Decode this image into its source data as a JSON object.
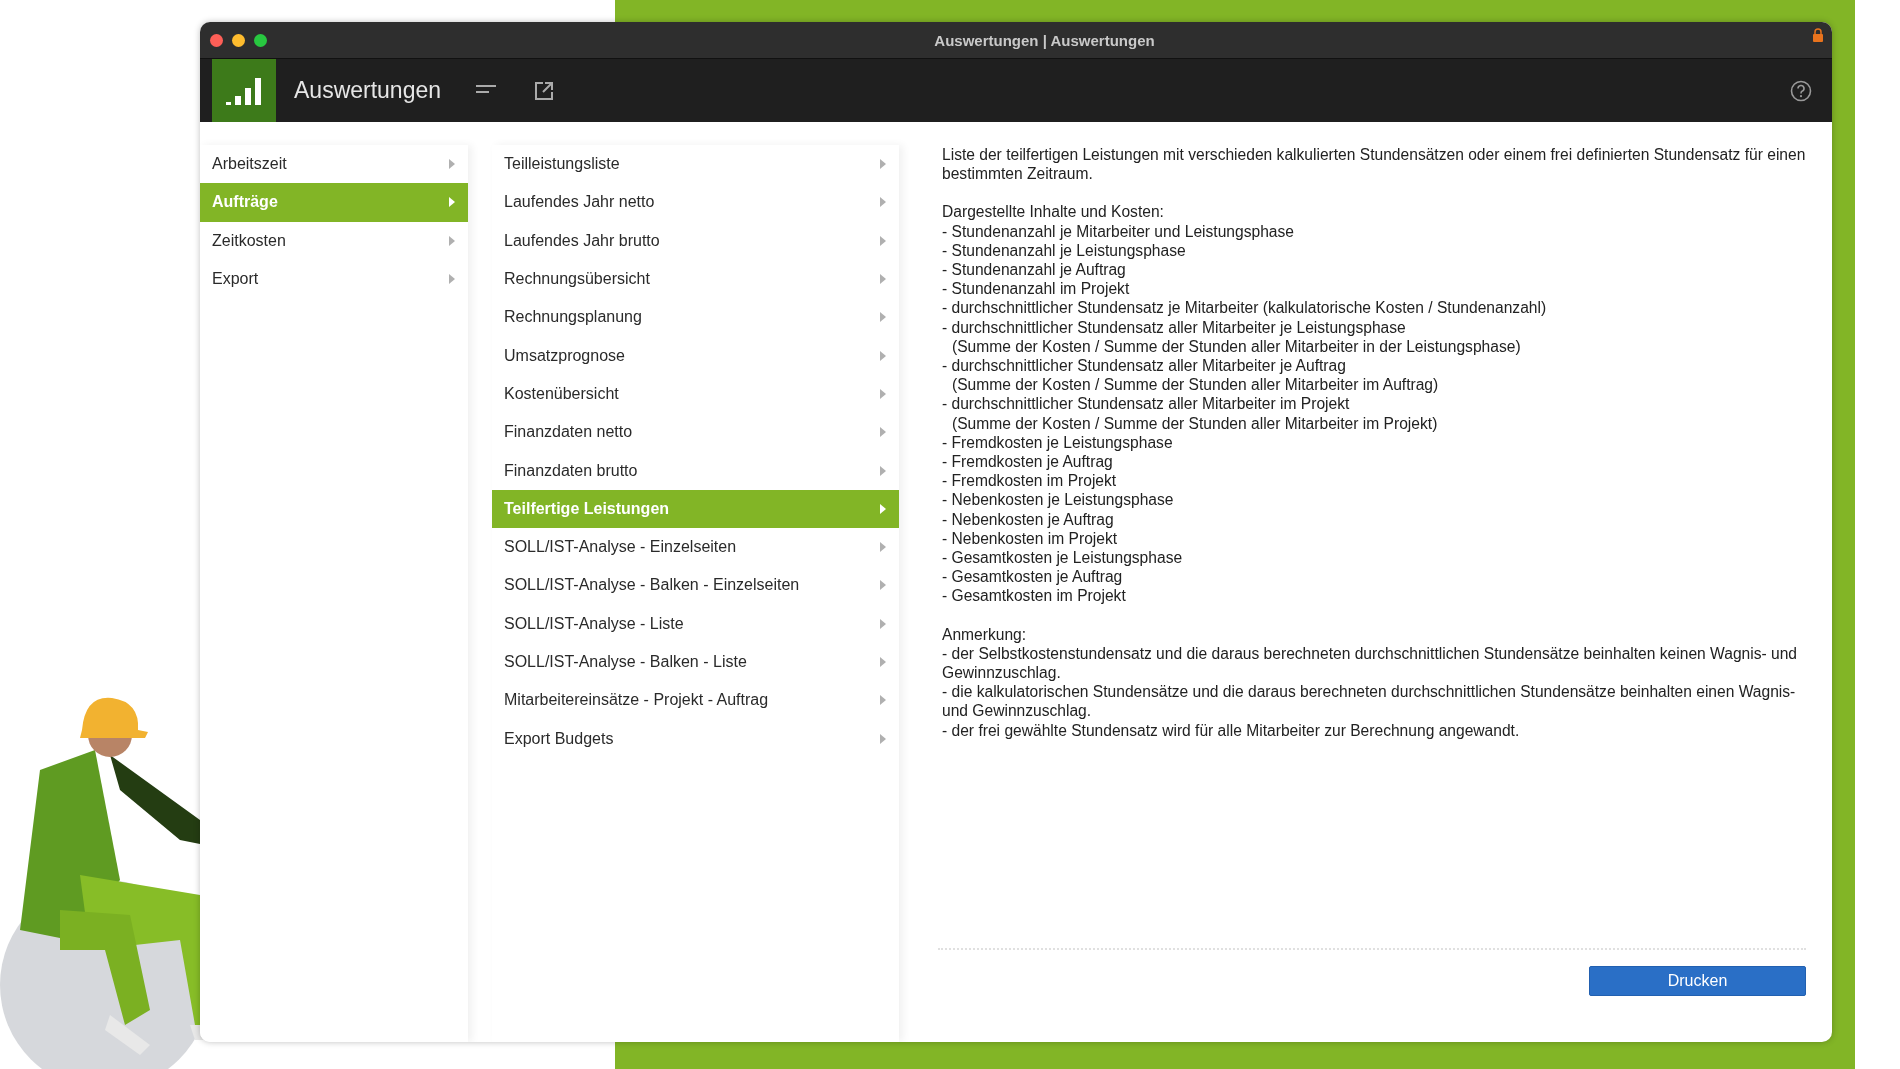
{
  "window": {
    "title": "Auswertungen | Auswertungen"
  },
  "toolbar": {
    "title": "Auswertungen"
  },
  "sidebar": {
    "items": [
      {
        "label": "Arbeitszeit",
        "selected": false
      },
      {
        "label": "Aufträge",
        "selected": true
      },
      {
        "label": "Zeitkosten",
        "selected": false
      },
      {
        "label": "Export",
        "selected": false
      }
    ]
  },
  "submenu": {
    "items": [
      {
        "label": "Teilleistungsliste",
        "selected": false
      },
      {
        "label": "Laufendes Jahr netto",
        "selected": false
      },
      {
        "label": "Laufendes Jahr brutto",
        "selected": false
      },
      {
        "label": "Rechnungsübersicht",
        "selected": false
      },
      {
        "label": "Rechnungsplanung",
        "selected": false
      },
      {
        "label": "Umsatzprognose",
        "selected": false
      },
      {
        "label": "Kostenübersicht",
        "selected": false
      },
      {
        "label": "Finanzdaten netto",
        "selected": false
      },
      {
        "label": "Finanzdaten brutto",
        "selected": false
      },
      {
        "label": "Teilfertige Leistungen",
        "selected": true
      },
      {
        "label": "SOLL/IST-Analyse - Einzelseiten",
        "selected": false
      },
      {
        "label": "SOLL/IST-Analyse - Balken - Einzelseiten",
        "selected": false
      },
      {
        "label": "SOLL/IST-Analyse - Liste",
        "selected": false
      },
      {
        "label": "SOLL/IST-Analyse - Balken - Liste",
        "selected": false
      },
      {
        "label": "Mitarbeitereinsätze - Projekt - Auftrag",
        "selected": false
      },
      {
        "label": "Export Budgets",
        "selected": false
      }
    ]
  },
  "description": {
    "intro": "Liste der teilfertigen Leistungen mit verschieden kalkulierten Stundensätzen oder einem frei definierten Stundensatz für einen bestimmten Zeitraum.",
    "sections": [
      {
        "heading": "Dargestellte Inhalte und Kosten:",
        "items": [
          {
            "text": "- Stundenanzahl je Mitarbeiter und Leistungsphase"
          },
          {
            "text": "- Stundenanzahl je Leistungsphase"
          },
          {
            "text": "- Stundenanzahl je Auftrag"
          },
          {
            "text": "- Stundenanzahl im Projekt"
          },
          {
            "text": "- durchschnittlicher Stundensatz je Mitarbeiter (kalkulatorische Kosten / Stundenanzahl)"
          },
          {
            "text": "- durchschnittlicher Stundensatz aller Mitarbeiter je Leistungsphase",
            "detail": "(Summe der Kosten / Summe der Stunden aller Mitarbeiter in der Leistungsphase)"
          },
          {
            "text": "- durchschnittlicher Stundensatz aller Mitarbeiter je Auftrag",
            "detail": "(Summe der Kosten / Summe der Stunden aller Mitarbeiter im Auftrag)"
          },
          {
            "text": "- durchschnittlicher Stundensatz aller Mitarbeiter im Projekt",
            "detail": "(Summe der Kosten / Summe der Stunden aller Mitarbeiter im Projekt)"
          },
          {
            "text": "- Fremdkosten je Leistungsphase"
          },
          {
            "text": "- Fremdkosten je Auftrag"
          },
          {
            "text": "- Fremdkosten im Projekt"
          },
          {
            "text": "- Nebenkosten je Leistungsphase"
          },
          {
            "text": "- Nebenkosten je Auftrag"
          },
          {
            "text": "- Nebenkosten im Projekt"
          },
          {
            "text": "- Gesamtkosten je Leistungsphase"
          },
          {
            "text": "- Gesamtkosten je Auftrag"
          },
          {
            "text": "- Gesamtkosten im Projekt"
          }
        ]
      },
      {
        "heading": "Anmerkung:",
        "items": [
          {
            "text": "- der Selbstkostenstundensatz und die daraus berechneten durchschnittlichen Stundensätze beinhalten keinen Wagnis- und Gewinnzuschlag."
          },
          {
            "text": "- die kalkulatorischen Stundensätze und die daraus berechneten durchschnittlichen Stundensätze beinhalten einen Wagnis- und Gewinnzuschlag."
          },
          {
            "text": "- der frei gewählte Stundensatz wird für alle Mitarbeiter zur Berechnung angewandt."
          }
        ]
      }
    ]
  },
  "print_button": "Drucken"
}
